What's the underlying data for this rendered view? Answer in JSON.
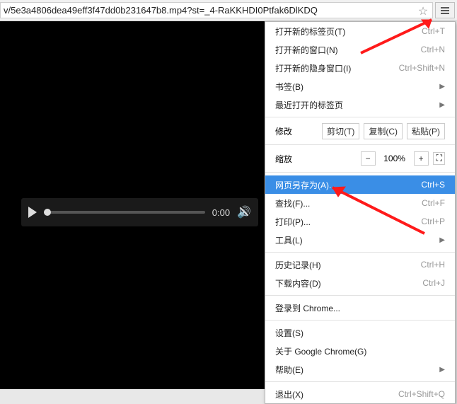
{
  "toolbar": {
    "url": "v/5e3a4806dea49eff3f47dd0b231647b8.mp4?st=_4-RaKKHDI0Ptfak6DlKDQ"
  },
  "video": {
    "time": "0:00"
  },
  "menu": {
    "new_tab": "打开新的标签页(T)",
    "new_tab_sc": "Ctrl+T",
    "new_window": "打开新的窗口(N)",
    "new_window_sc": "Ctrl+N",
    "incognito": "打开新的隐身窗口(I)",
    "incognito_sc": "Ctrl+Shift+N",
    "bookmarks": "书签(B)",
    "recent_tabs": "最近打开的标签页",
    "edit_label": "修改",
    "cut": "剪切(T)",
    "copy": "复制(C)",
    "paste": "粘贴(P)",
    "zoom_label": "缩放",
    "zoom_minus": "−",
    "zoom_pct": "100%",
    "zoom_plus": "+",
    "save_as": "网页另存为(A)...",
    "save_as_sc": "Ctrl+S",
    "find": "查找(F)...",
    "find_sc": "Ctrl+F",
    "print": "打印(P)...",
    "print_sc": "Ctrl+P",
    "tools": "工具(L)",
    "history": "历史记录(H)",
    "history_sc": "Ctrl+H",
    "downloads": "下载内容(D)",
    "downloads_sc": "Ctrl+J",
    "signin": "登录到 Chrome...",
    "settings": "设置(S)",
    "about": "关于 Google Chrome(G)",
    "help": "帮助(E)",
    "exit": "退出(X)",
    "exit_sc": "Ctrl+Shift+Q"
  }
}
